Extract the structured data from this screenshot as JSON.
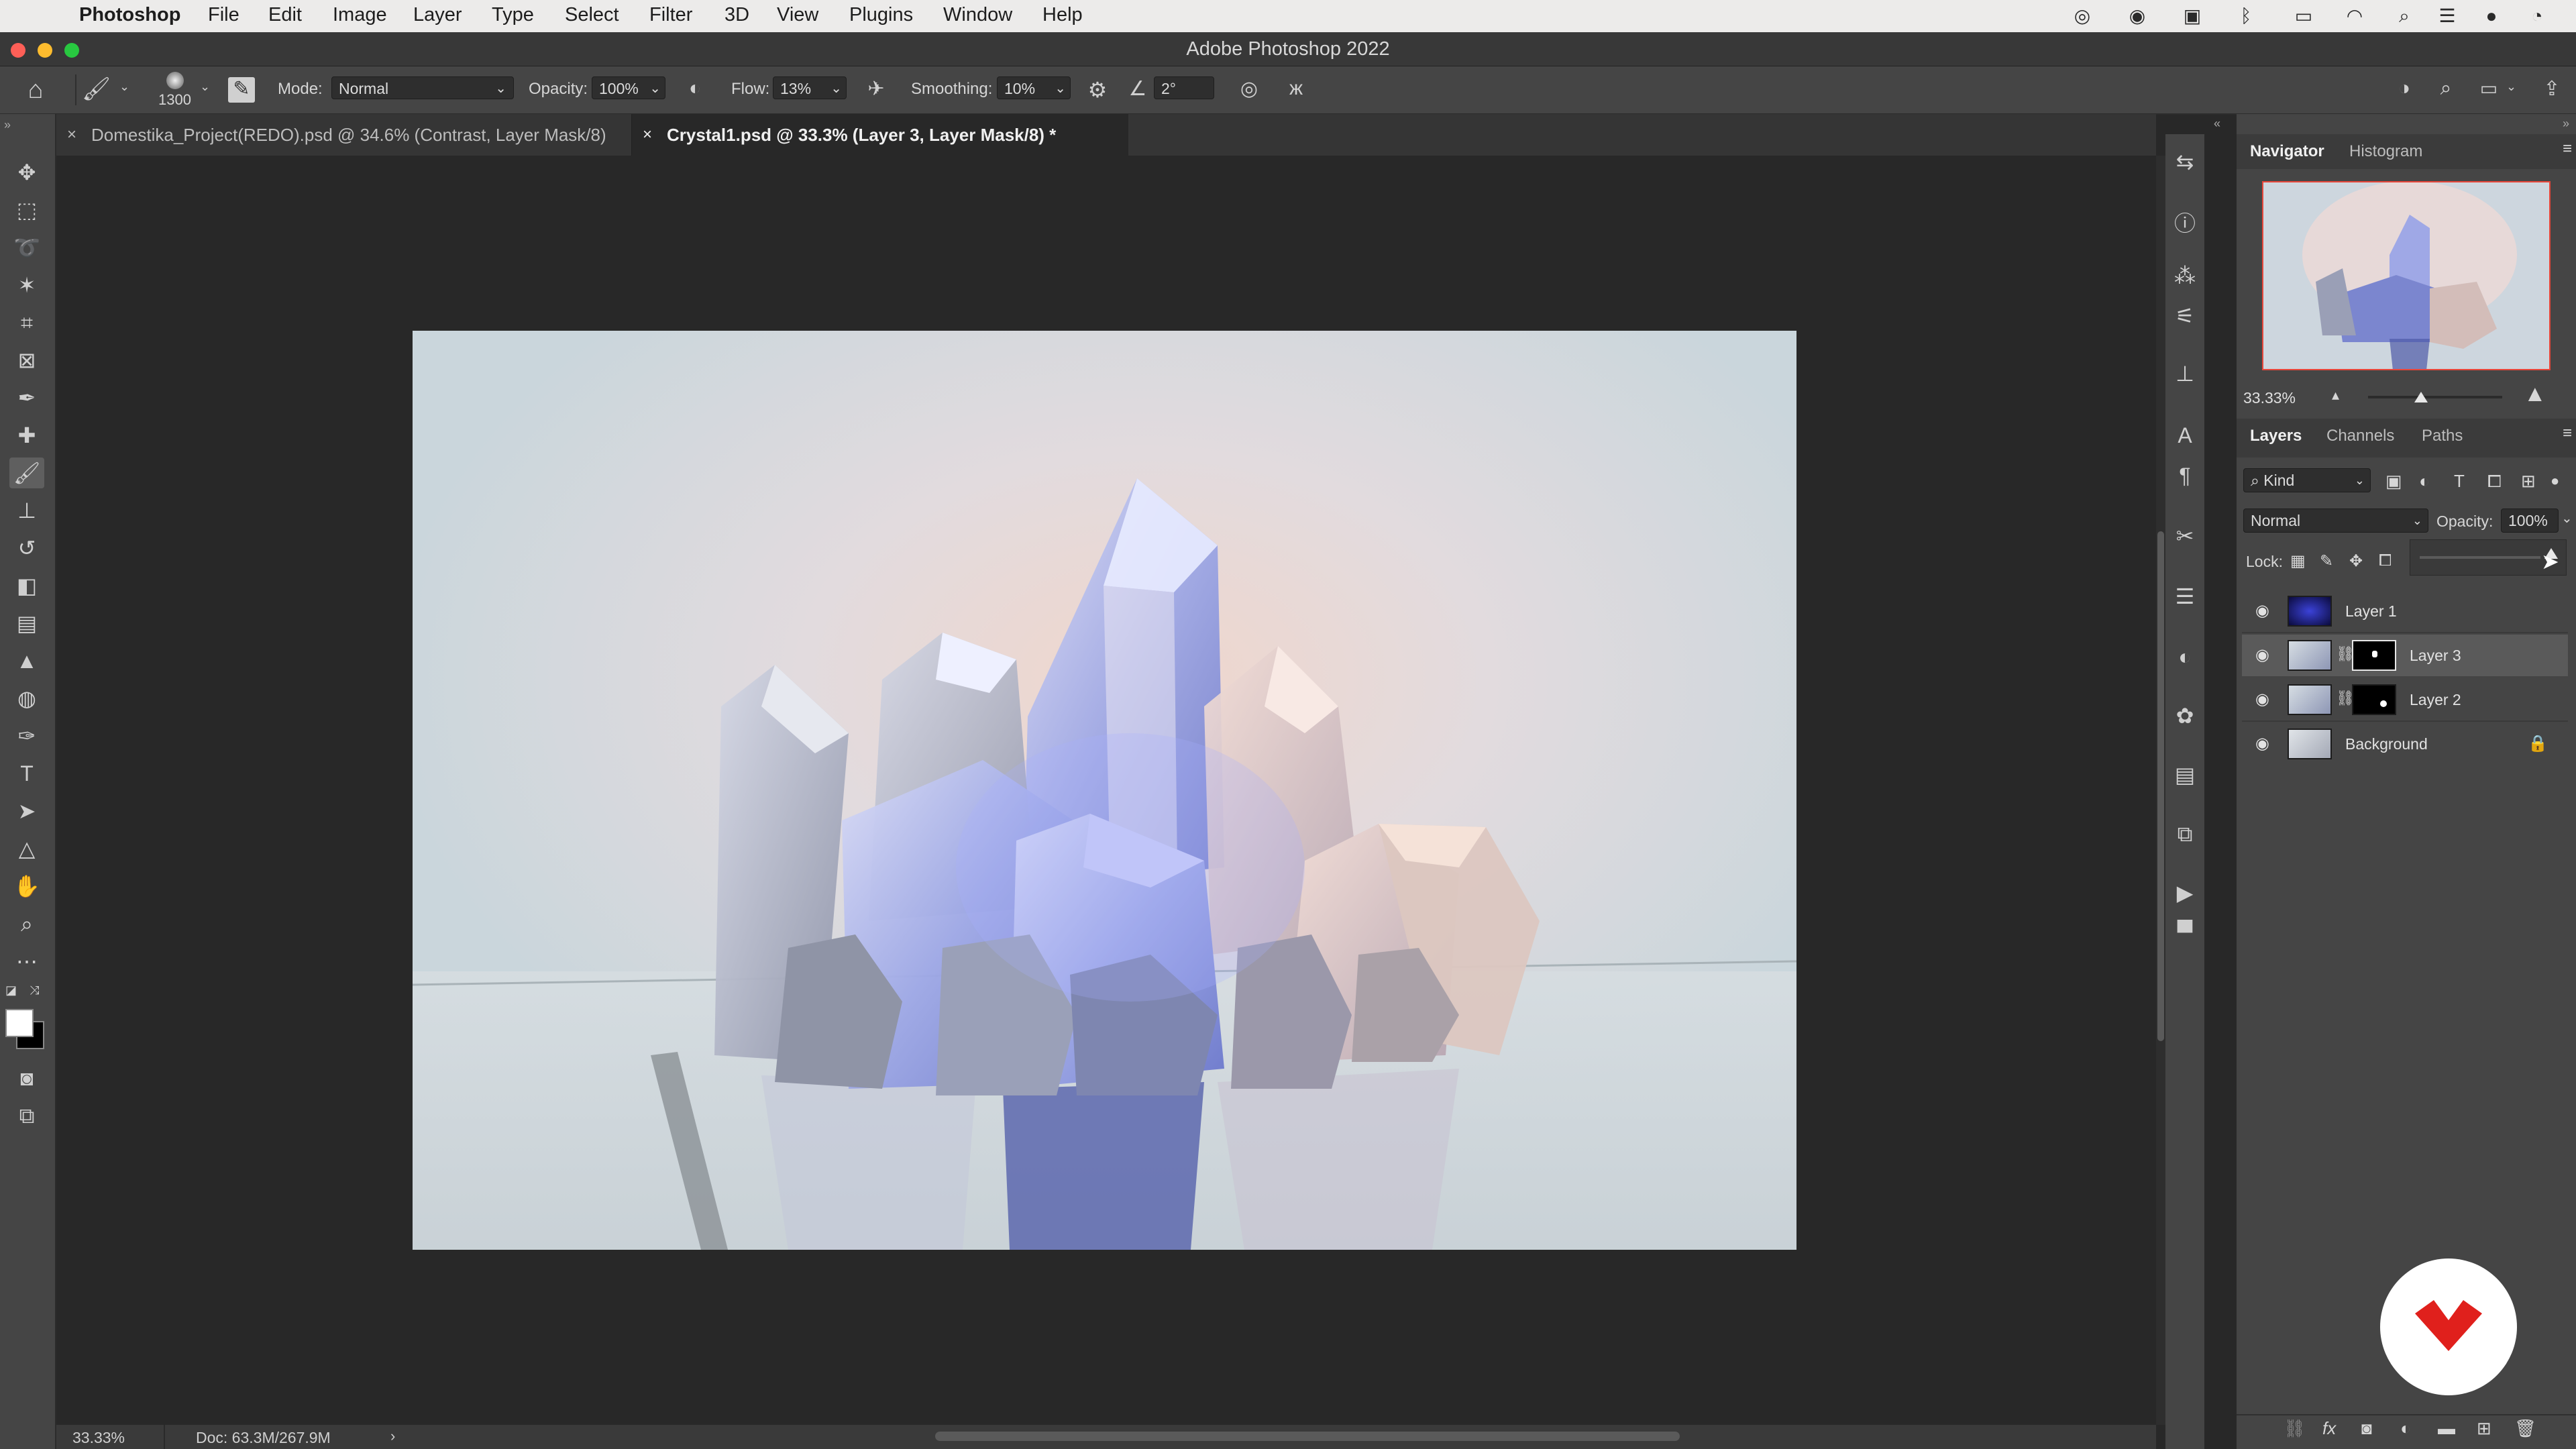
{
  "menubar": {
    "app_name": "Photoshop",
    "items": [
      "File",
      "Edit",
      "Image",
      "Layer",
      "Type",
      "Select",
      "Filter",
      "3D",
      "View",
      "Plugins",
      "Window",
      "Help"
    ]
  },
  "window": {
    "title": "Adobe Photoshop 2022"
  },
  "options": {
    "brush_size": "1300",
    "mode_label": "Mode:",
    "mode_value": "Normal",
    "opacity_label": "Opacity:",
    "opacity_value": "100%",
    "flow_label": "Flow:",
    "flow_value": "13%",
    "smoothing_label": "Smoothing:",
    "smoothing_value": "10%",
    "angle_value": "2°"
  },
  "tabs": [
    {
      "label": "Domestika_Project(REDO).psd @ 34.6% (Contrast, Layer Mask/8)",
      "active": false
    },
    {
      "label": "Crystal1.psd @ 33.3% (Layer 3, Layer Mask/8) *",
      "active": true
    }
  ],
  "status": {
    "zoom": "33.33%",
    "doc": "Doc: 63.3M/267.9M"
  },
  "navigator": {
    "tabs": [
      "Navigator",
      "Histogram"
    ],
    "zoom": "33.33%"
  },
  "layers_panel": {
    "tabs": [
      "Layers",
      "Channels",
      "Paths"
    ],
    "kind_label": "Kind",
    "blend_mode": "Normal",
    "opacity_label": "Opacity:",
    "opacity_value": "100%",
    "lock_label": "Lock:",
    "layers": [
      {
        "name": "Layer 1",
        "selected": false,
        "has_mask": false,
        "locked": false
      },
      {
        "name": "Layer 3",
        "selected": true,
        "has_mask": true,
        "locked": false
      },
      {
        "name": "Layer 2",
        "selected": false,
        "has_mask": true,
        "locked": false
      },
      {
        "name": "Background",
        "selected": false,
        "has_mask": false,
        "locked": true
      }
    ]
  },
  "colors": {
    "accent_active_tab": "#282828",
    "selected_layer": "#5a5a5a",
    "navigator_frame": "#e8463a",
    "logo_red": "#e0201c"
  }
}
